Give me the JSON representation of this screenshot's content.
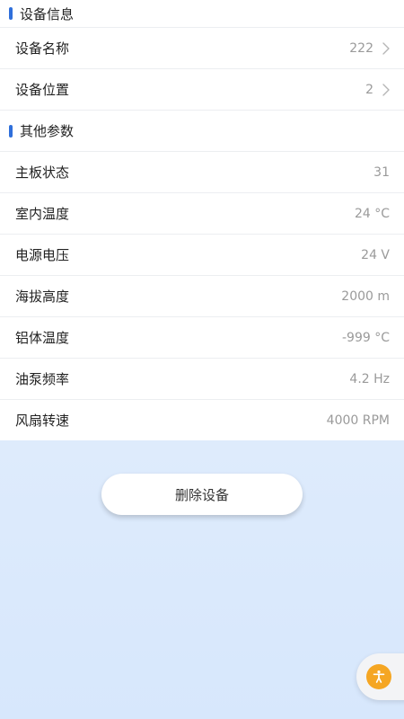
{
  "device_info": {
    "header": "设备信息",
    "rows": [
      {
        "label": "设备名称",
        "value": "222"
      },
      {
        "label": "设备位置",
        "value": "2"
      }
    ]
  },
  "other_params": {
    "header": "其他参数",
    "rows": [
      {
        "label": "主板状态",
        "value": "31"
      },
      {
        "label": "室内温度",
        "value": "24 °C"
      },
      {
        "label": "电源电压",
        "value": "24 V"
      },
      {
        "label": "海拔高度",
        "value": "2000 m"
      },
      {
        "label": "铝体温度",
        "value": "-999 °C"
      },
      {
        "label": "油泵频率",
        "value": "4.2 Hz"
      },
      {
        "label": "风扇转速",
        "value": "4000 RPM"
      }
    ]
  },
  "actions": {
    "delete_label": "删除设备"
  },
  "colors": {
    "accent": "#2f6fdb",
    "a11y_button": "#f5a623"
  },
  "icons": {
    "chevron": "chevron-right-icon",
    "accessibility": "accessibility-icon"
  }
}
